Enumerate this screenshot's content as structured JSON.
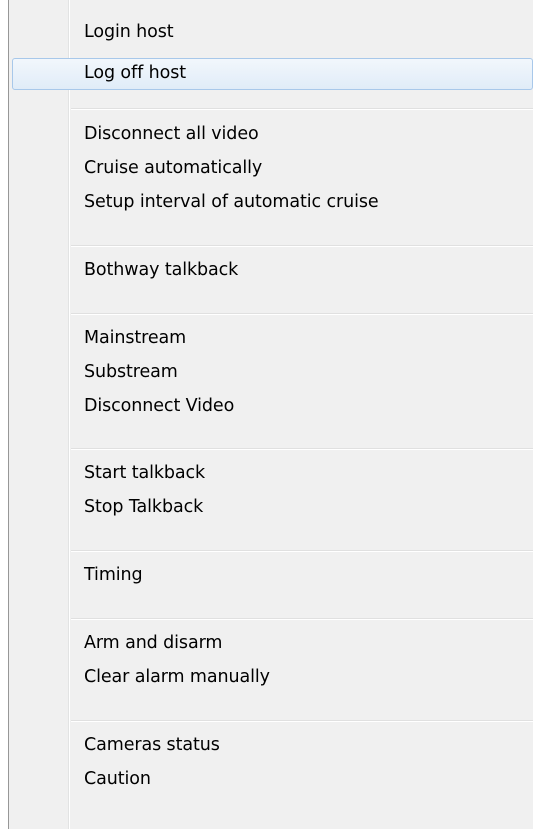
{
  "menu": {
    "items": [
      {
        "label": "Login host"
      },
      {
        "label": "Log off host"
      },
      {
        "label": "Disconnect all video"
      },
      {
        "label": "Cruise automatically"
      },
      {
        "label": "Setup interval of automatic cruise"
      },
      {
        "label": "Bothway talkback"
      },
      {
        "label": "Mainstream"
      },
      {
        "label": "Substream"
      },
      {
        "label": "Disconnect Video"
      },
      {
        "label": "Start talkback"
      },
      {
        "label": "Stop Talkback"
      },
      {
        "label": "Timing"
      },
      {
        "label": "Arm and disarm"
      },
      {
        "label": "Clear alarm manually"
      },
      {
        "label": "Cameras status"
      },
      {
        "label": "Caution"
      }
    ],
    "highlighted_index": 1
  }
}
